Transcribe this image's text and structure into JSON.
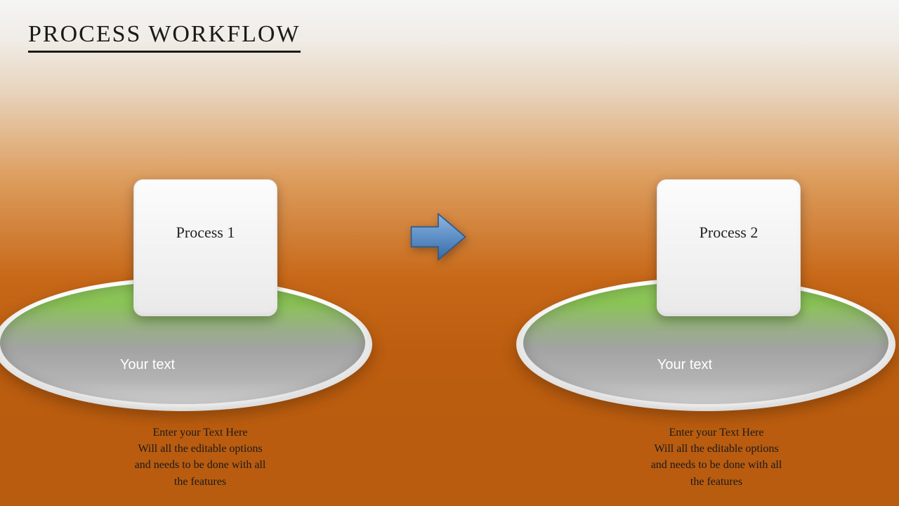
{
  "title": "PROCESS WORKFLOW",
  "arrow": {
    "name": "right-arrow-icon",
    "color_top": "#7ea9d8",
    "color_bottom": "#3b6da8"
  },
  "processes": [
    {
      "card_label": "Process 1",
      "disc_label": "Your text",
      "desc_line1": "Enter your Text Here",
      "desc_line2": "Will all the editable options",
      "desc_line3": "and needs to be done with all",
      "desc_line4": "the features"
    },
    {
      "card_label": "Process 2",
      "disc_label": "Your text",
      "desc_line1": "Enter your Text Here",
      "desc_line2": "Will all the editable options",
      "desc_line3": "and needs to be done with all",
      "desc_line4": "the features"
    }
  ]
}
